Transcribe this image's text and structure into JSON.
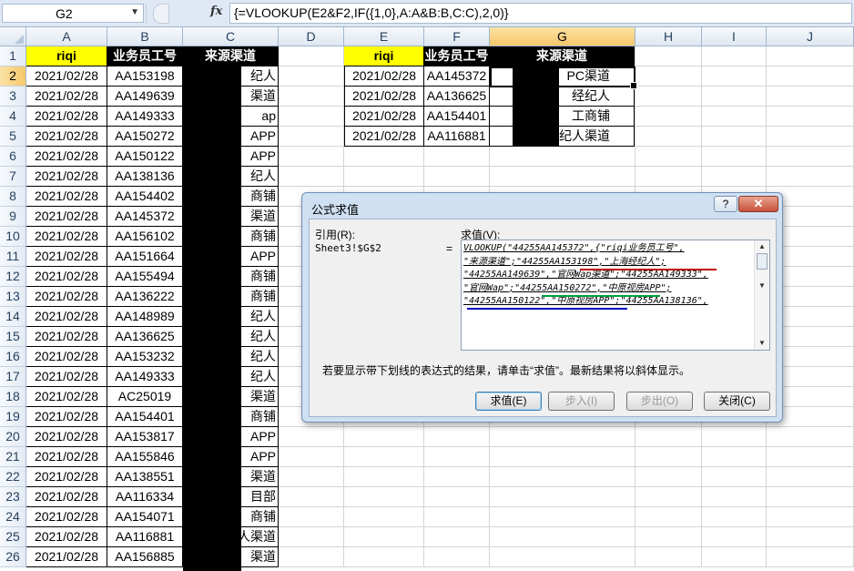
{
  "formula_bar": {
    "name_box": "G2",
    "fx": "fx",
    "formula": "{=VLOOKUP(E2&F2,IF({1,0},A:A&B:B,C:C),2,0)}"
  },
  "columns": [
    "A",
    "B",
    "C",
    "D",
    "E",
    "F",
    "G",
    "H",
    "I",
    "J"
  ],
  "rows": [
    "1",
    "2",
    "3",
    "4",
    "5",
    "6",
    "7",
    "8",
    "9",
    "10",
    "11",
    "12",
    "13",
    "14",
    "15",
    "16",
    "17",
    "18",
    "19",
    "20",
    "21",
    "22",
    "23",
    "24",
    "25",
    "26"
  ],
  "left_table": {
    "headers": [
      "riqi",
      "业务员工号",
      "来源渠道"
    ],
    "dates": [
      "2021/02/28",
      "2021/02/28",
      "2021/02/28",
      "2021/02/28",
      "2021/02/28",
      "2021/02/28",
      "2021/02/28",
      "2021/02/28",
      "2021/02/28",
      "2021/02/28",
      "2021/02/28",
      "2021/02/28",
      "2021/02/28",
      "2021/02/28",
      "2021/02/28",
      "2021/02/28",
      "2021/02/28",
      "2021/02/28",
      "2021/02/28",
      "2021/02/28",
      "2021/02/28",
      "2021/02/28",
      "2021/02/28",
      "2021/02/28",
      "2021/02/28"
    ],
    "ids": [
      "AA153198",
      "AA149639",
      "AA149333",
      "AA150272",
      "AA150122",
      "AA138136",
      "AA154402",
      "AA145372",
      "AA156102",
      "AA151664",
      "AA155494",
      "AA136222",
      "AA148989",
      "AA136625",
      "AA153232",
      "AA149333",
      "AC25019",
      "AA154401",
      "AA153817",
      "AA155846",
      "AA138551",
      "AA116334",
      "AA154071",
      "AA116881",
      "AA156885"
    ],
    "channels_visible": [
      "纪人",
      "渠道",
      "ap",
      "APP",
      "APP",
      "纪人",
      "商铺",
      "渠道",
      "商铺",
      "APP",
      "商铺",
      "商铺",
      "纪人",
      "纪人",
      "纪人",
      "纪人",
      "渠道",
      "商铺",
      "APP",
      "APP",
      "渠道",
      "目部",
      "商铺",
      "人渠道",
      "渠道"
    ]
  },
  "right_table": {
    "headers": [
      "riqi",
      "业务员工号",
      "来源渠道"
    ],
    "dates": [
      "2021/02/28",
      "2021/02/28",
      "2021/02/28",
      "2021/02/28"
    ],
    "ids": [
      "AA145372",
      "AA136625",
      "AA154401",
      "AA116881"
    ],
    "channels_visible": [
      "PC渠道",
      "经纪人",
      "工商铺",
      "纪人渠道"
    ]
  },
  "dialog": {
    "title": "公式求值",
    "help_button": "?",
    "close_x": "✕",
    "ref_label": "引用(R):",
    "ref_value": "Sheet3!$G$2",
    "equals": "=",
    "eval_label": "求值(V):",
    "eval_lines": [
      "VLOOKUP(\"44255AA145372\",{\"riqi业务员工号\",",
      "\"来源渠道\";\"44255AA153198\",\"上海经纪人\";",
      "\"44255AA149639\",\"官网Wap渠道\";\"44255AA149333\",",
      "\"官网Wap\";\"44255AA150272\",\"中原视房APP\";",
      "\"44255AA150122\",\"中原视房APP\";\"44255AA138136\","
    ],
    "hint": "若要显示带下划线的表达式的结果，请单击“求值”。最新结果将以斜体显示。",
    "buttons": {
      "evaluate": "求值(E)",
      "step_in": "步入(I)",
      "step_out": "步出(O)",
      "close": "关闭(C)"
    },
    "underline_colors": [
      "#c00000",
      "#00a040",
      "#0000c0"
    ]
  }
}
